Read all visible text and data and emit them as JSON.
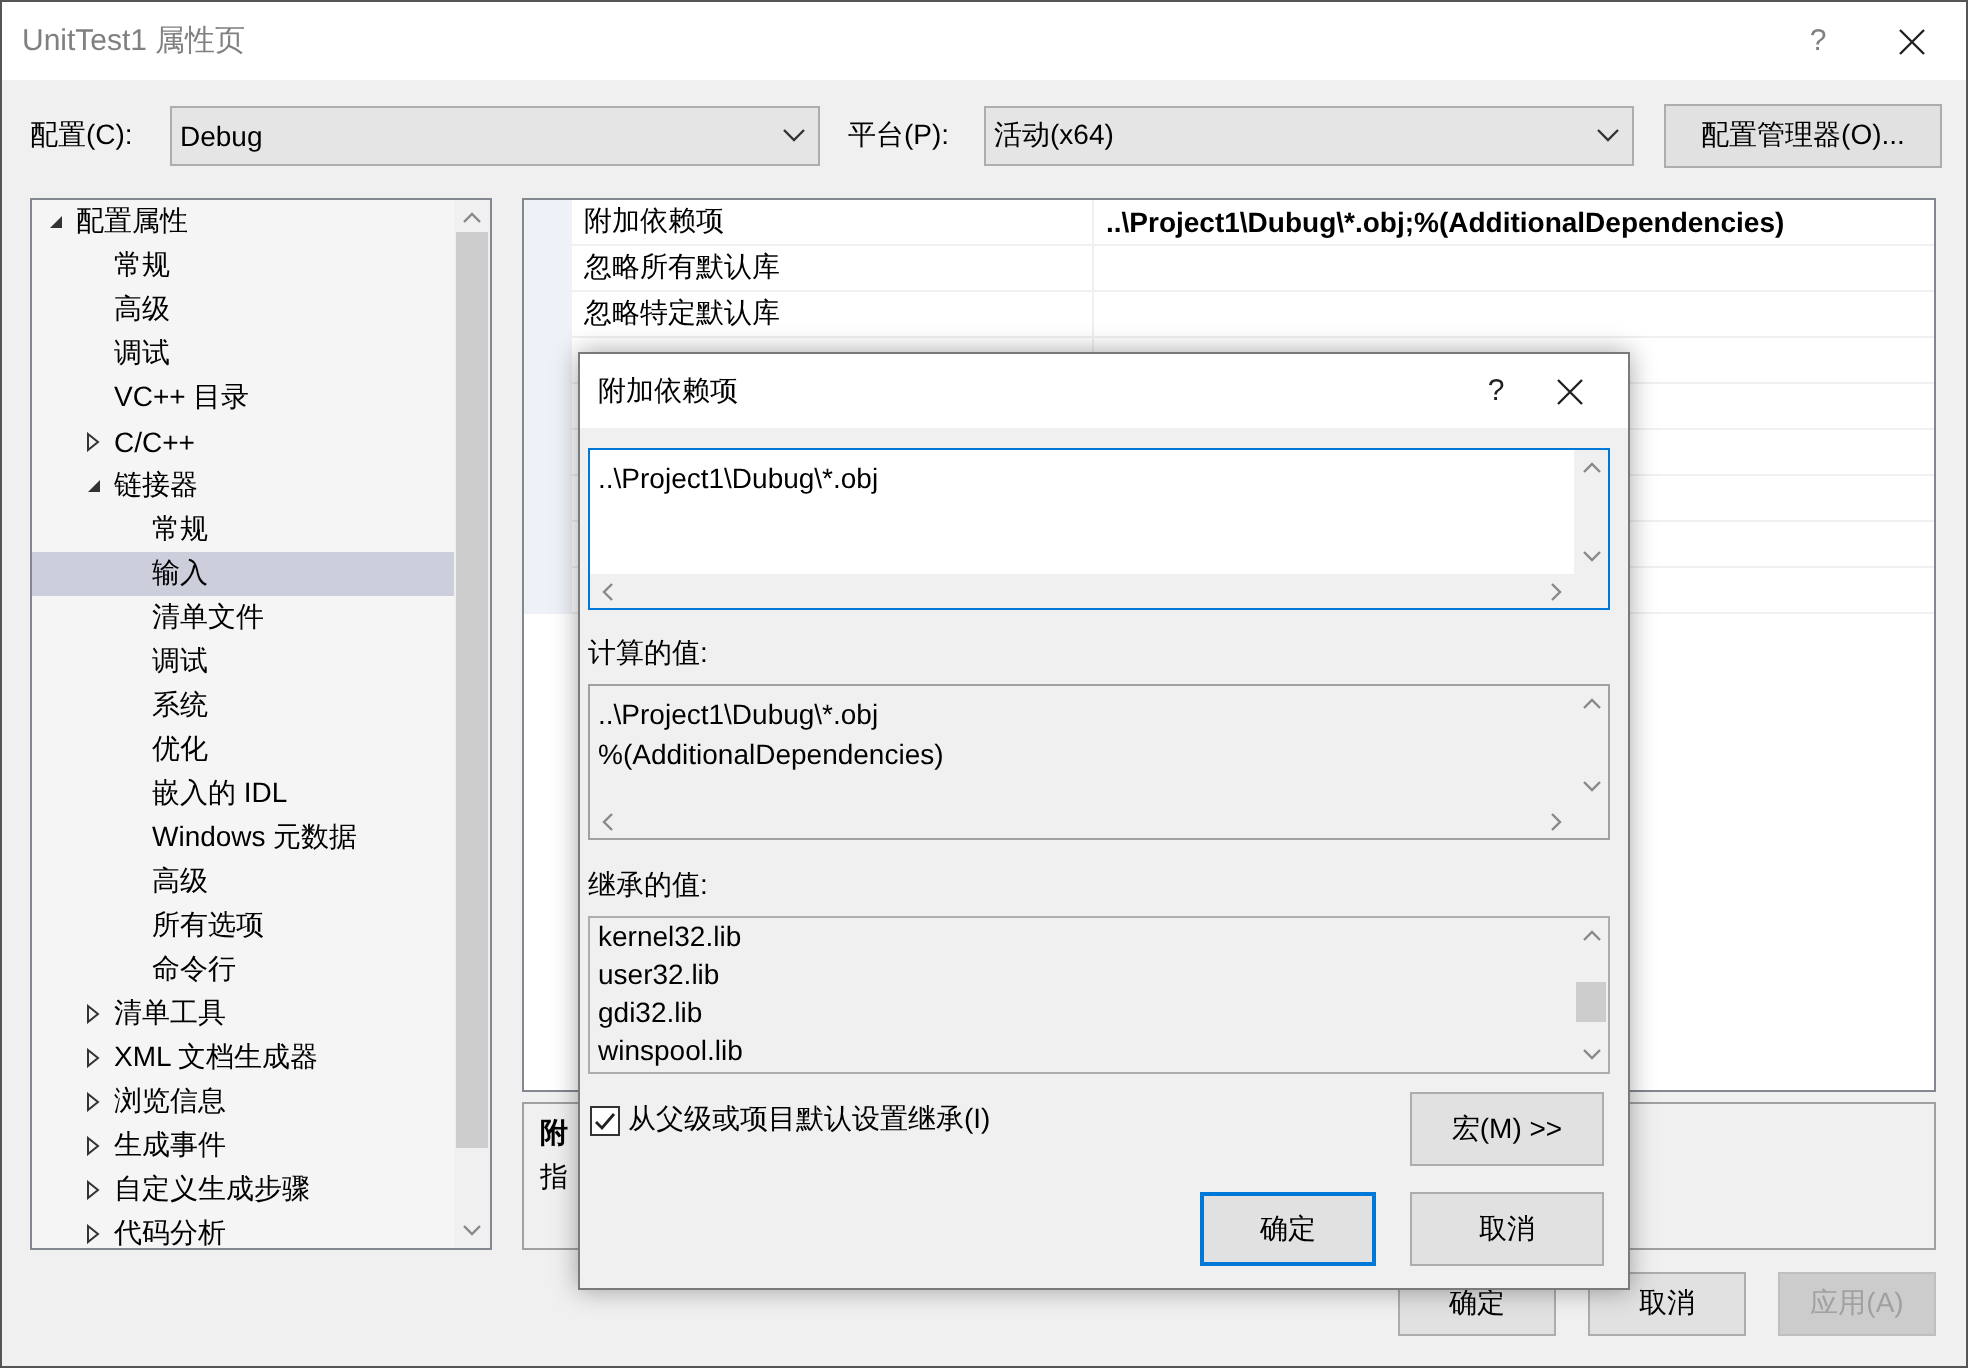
{
  "window": {
    "title": "UnitTest1 属性页",
    "help_button": "?"
  },
  "config_bar": {
    "config_label": "配置(C):",
    "config_value": "Debug",
    "platform_label": "平台(P):",
    "platform_value": "活动(x64)",
    "manager_button": "配置管理器(O)..."
  },
  "tree": [
    {
      "label": "配置属性",
      "expanded": true,
      "selected": false,
      "children": [
        {
          "label": "常规",
          "selected": false
        },
        {
          "label": "高级",
          "selected": false
        },
        {
          "label": "调试",
          "selected": false
        },
        {
          "label": "VC++ 目录",
          "selected": false
        },
        {
          "label": "C/C++",
          "expanded": false,
          "selected": false
        },
        {
          "label": "链接器",
          "expanded": true,
          "selected": false,
          "children": [
            {
              "label": "常规",
              "selected": false
            },
            {
              "label": "输入",
              "selected": true
            },
            {
              "label": "清单文件",
              "selected": false
            },
            {
              "label": "调试",
              "selected": false
            },
            {
              "label": "系统",
              "selected": false
            },
            {
              "label": "优化",
              "selected": false
            },
            {
              "label": "嵌入的 IDL",
              "selected": false
            },
            {
              "label": "Windows 元数据",
              "selected": false
            },
            {
              "label": "高级",
              "selected": false
            },
            {
              "label": "所有选项",
              "selected": false
            },
            {
              "label": "命令行",
              "selected": false
            }
          ]
        },
        {
          "label": "清单工具",
          "expanded": false,
          "selected": false
        },
        {
          "label": "XML 文档生成器",
          "expanded": false,
          "selected": false
        },
        {
          "label": "浏览信息",
          "expanded": false,
          "selected": false
        },
        {
          "label": "生成事件",
          "expanded": false,
          "selected": false
        },
        {
          "label": "自定义生成步骤",
          "expanded": false,
          "selected": false
        },
        {
          "label": "代码分析",
          "expanded": false,
          "selected": false
        }
      ]
    }
  ],
  "properties": [
    {
      "name": "附加依赖项",
      "value": "..\\Project1\\Dubug\\*.obj;%(AdditionalDependencies)"
    },
    {
      "name": "忽略所有默认库"
    },
    {
      "name": "忽略特定默认库"
    }
  ],
  "description": {
    "title": "附",
    "text": "指"
  },
  "buttons": [
    {
      "label": "确定",
      "disabled": false
    },
    {
      "label": "取消",
      "disabled": false
    },
    {
      "label": "应用(A)",
      "disabled": true
    }
  ],
  "dialog": {
    "title": "附加依赖项",
    "help_button": "?",
    "edit_value": "..\\Project1\\Dubug\\*.obj",
    "focused": true,
    "computed_label": "计算的值:",
    "computed_lines": [
      "..\\Project1\\Dubug\\*.obj",
      "%(AdditionalDependencies)"
    ],
    "inherited_label": "继承的值:",
    "inherited_items": [
      "kernel32.lib",
      "user32.lib",
      "gdi32.lib",
      "winspool.lib"
    ],
    "inherit_checkbox": {
      "label": "从父级或项目默认设置继承(I)",
      "checked": true
    },
    "macro_button": "宏(M) >>",
    "buttons": [
      {
        "label": "确定",
        "default": true
      },
      {
        "label": "取消",
        "default": false
      }
    ]
  }
}
